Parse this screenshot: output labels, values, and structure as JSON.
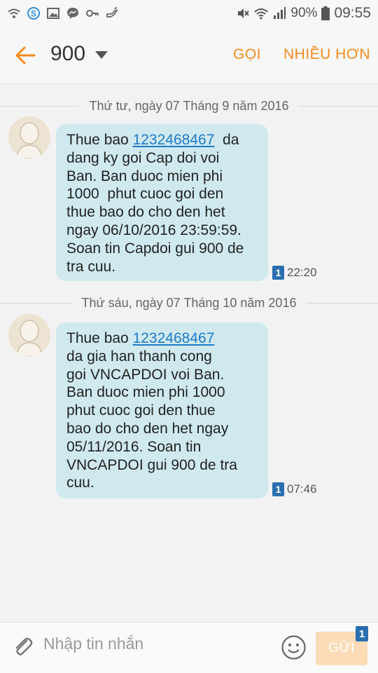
{
  "status_bar": {
    "battery": "90%",
    "time": "09:55",
    "left_icons": [
      "wifi-call-icon",
      "skype-icon",
      "gallery-icon",
      "messenger-icon",
      "key-icon",
      "hand-icon"
    ],
    "right_icons": [
      "mute-icon",
      "wifi-icon",
      "signal-icon",
      "battery-icon"
    ]
  },
  "header": {
    "contact": "900",
    "call_label": "GỌI",
    "more_label": "NHIỀU HƠN"
  },
  "messages": [
    {
      "date": "Thứ tư, ngày 07 Tháng 9 năm 2016",
      "line1_pre": "Thue bao ",
      "phone": "1232468467",
      "line1_post": "  da",
      "lines": [
        "dang ky goi Cap doi voi",
        "Ban. Ban duoc mien phi",
        "1000  phut cuoc goi den",
        "thue bao do cho den het",
        "ngay 06/10/2016 23:59:59.",
        "Soan tin Capdoi gui 900 de",
        "tra cuu."
      ],
      "sim": "1",
      "time": "22:20"
    },
    {
      "date": "Thứ sáu, ngày 07 Tháng 10 năm 2016",
      "line1_pre": "Thue bao ",
      "phone": "1232468467",
      "line1_post": "",
      "lines": [
        "da gia han thanh cong",
        "goi VNCAPDOI voi Ban.",
        "Ban duoc mien phi 1000",
        "phut cuoc goi den thue",
        "bao do cho den het ngay",
        "05/11/2016. Soan tin",
        "VNCAPDOI gui 900 de tra",
        "cuu."
      ],
      "sim": "1",
      "time": "07:46"
    }
  ],
  "composer": {
    "placeholder": "Nhập tin nhắn",
    "send_label": "GỬI",
    "send_sim": "1"
  },
  "colors": {
    "accent": "#f28a1c",
    "bubble": "#cfe9ef",
    "link": "#1f7bc7",
    "sim_badge": "#2a6fb0"
  }
}
